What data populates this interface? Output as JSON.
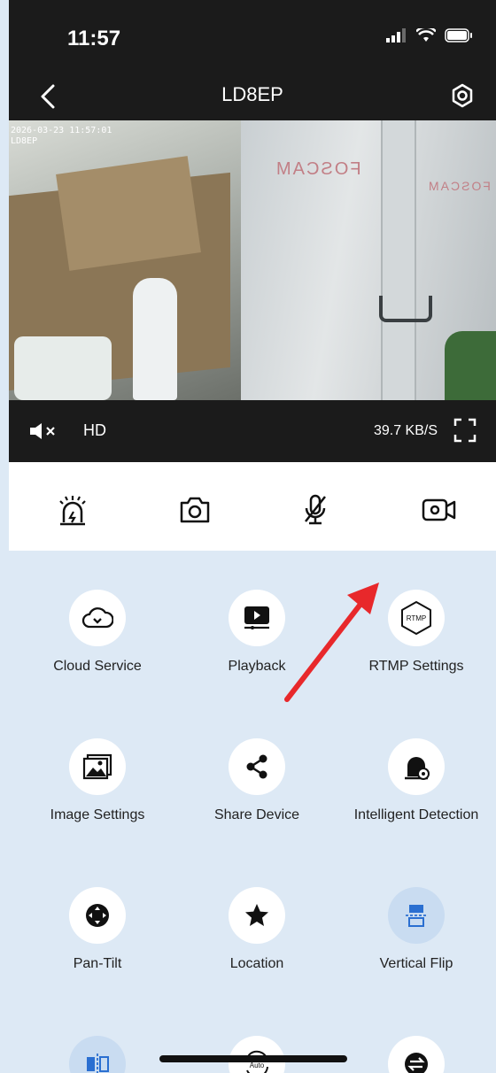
{
  "status_bar": {
    "time": "11:57"
  },
  "nav": {
    "title": "LD8EP",
    "back_icon": "chevron-left-icon",
    "settings_icon": "gear-icon"
  },
  "video": {
    "timestamp_line1": "2026-03-23 11:57:01",
    "timestamp_line2": "LD8EP",
    "brand_left": "FOSCAM",
    "brand_right": "FOSCAM"
  },
  "video_toolbar": {
    "quality": "HD",
    "bitrate": "39.7 KB/S"
  },
  "actions": [
    {
      "name": "siren",
      "icon": "siren-icon"
    },
    {
      "name": "snapshot",
      "icon": "camera-icon"
    },
    {
      "name": "talk",
      "icon": "microphone-muted-icon"
    },
    {
      "name": "record",
      "icon": "video-record-icon"
    }
  ],
  "grid": {
    "items": [
      {
        "label": "Cloud Service",
        "icon": "cloud-icon"
      },
      {
        "label": "Playback",
        "icon": "playback-icon"
      },
      {
        "label": "RTMP Settings",
        "icon": "rtmp-icon",
        "badge": "RTMP"
      },
      {
        "label": "Image Settings",
        "icon": "image-icon"
      },
      {
        "label": "Share Device",
        "icon": "share-icon"
      },
      {
        "label": "Intelligent Detection",
        "icon": "detection-icon"
      },
      {
        "label": "Pan-Tilt",
        "icon": "pan-tilt-icon"
      },
      {
        "label": "Location",
        "icon": "star-icon"
      },
      {
        "label": "Vertical Flip",
        "icon": "vertical-flip-icon"
      },
      {
        "label": "",
        "icon": "horizontal-flip-icon"
      },
      {
        "label": "",
        "icon": "auto-icon",
        "badge": "Auto"
      },
      {
        "label": "",
        "icon": "switch-icon"
      }
    ]
  },
  "colors": {
    "accent": "#e8282b",
    "dark_bar": "#1b1b1b",
    "panel_bg": "#dde9f5",
    "blue_circle": "#c9dcf1"
  }
}
